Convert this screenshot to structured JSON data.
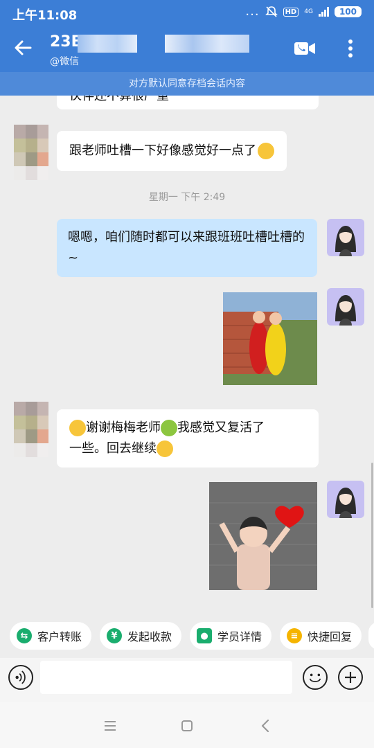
{
  "status": {
    "time": "上午11:08",
    "dots": "...",
    "hd": "HD",
    "net": "4G",
    "battery": "100"
  },
  "header": {
    "title": "23B",
    "subtitle": "@微信"
  },
  "notice": "对方默认同意存档会话内容",
  "messages": {
    "m0": "伙伴还不算很严重",
    "m1": "跟老师吐槽一下好像感觉好一点了",
    "timestamp": "星期一 下午 2:49",
    "m2": "嗯嗯，咱们随时都可以来跟班班吐槽吐槽的~",
    "m4_line1": "谢谢梅梅老师",
    "m4_line1b": "我感觉又复活了",
    "m4_line2": "一些。回去继续"
  },
  "quick_actions": [
    "客户转账",
    "发起收款",
    "学员详情",
    "快捷回复"
  ],
  "input": {
    "placeholder": ""
  },
  "icons": {
    "back": "back-arrow-icon",
    "video": "video-call-icon",
    "more": "more-vertical-icon",
    "voice": "voice-icon",
    "emoji": "emoji-icon",
    "plus": "plus-icon",
    "menu": "menu-icon",
    "home": "home-icon",
    "back_nav": "back-nav-icon"
  },
  "colors": {
    "header": "#3c7ed6",
    "notice": "#4f8ad9",
    "bubble_right": "#c9e6ff",
    "transfer": "#1aad6e",
    "payment": "#1aad6e",
    "student": "#1aad6e",
    "quick": "#f5b400"
  }
}
